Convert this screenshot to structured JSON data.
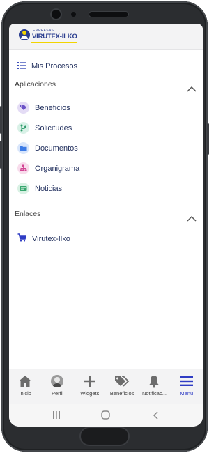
{
  "header": {
    "logo": {
      "top_text": "EMPRESAS",
      "main_text": "VIRUTEX-ILKO",
      "color": "#2a3d8f",
      "accent": "#f2d400"
    }
  },
  "mis_procesos": {
    "label": "Mis Procesos",
    "icon": "list-icon"
  },
  "aplicaciones": {
    "title": "Aplicaciones",
    "expanded": true,
    "items": [
      {
        "label": "Beneficios",
        "icon": "tag-icon",
        "icon_bg": "#e4dcf5",
        "icon_color": "#6b52c7"
      },
      {
        "label": "Solicitudes",
        "icon": "branch-icon",
        "icon_bg": "#d9f1e7",
        "icon_color": "#2e9a6a"
      },
      {
        "label": "Documentos",
        "icon": "folder-icon",
        "icon_bg": "#d9e6fb",
        "icon_color": "#3d7ce6"
      },
      {
        "label": "Organigrama",
        "icon": "org-chart-icon",
        "icon_bg": "#f8dcec",
        "icon_color": "#d24594"
      },
      {
        "label": "Noticias",
        "icon": "news-icon",
        "icon_bg": "#d9f1e4",
        "icon_color": "#37a66e"
      }
    ]
  },
  "enlaces": {
    "title": "Enlaces",
    "expanded": true,
    "items": [
      {
        "label": "Virutex-Ilko",
        "icon": "cart-icon",
        "icon_color": "#2f3cc4"
      }
    ]
  },
  "tabbar": {
    "tabs": [
      {
        "label": "Inicio",
        "icon": "home-icon"
      },
      {
        "label": "Perfil",
        "icon": "avatar"
      },
      {
        "label": "Widgets",
        "icon": "plus-icon"
      },
      {
        "label": "Beneficios",
        "icon": "tags-icon"
      },
      {
        "label": "Notificac...",
        "icon": "bell-icon"
      },
      {
        "label": "Menú",
        "icon": "hamburger-icon",
        "active": true,
        "active_color": "#2f3cc4"
      }
    ]
  },
  "android_nav": {
    "buttons": [
      "recents-icon",
      "home-circle-icon",
      "back-icon"
    ]
  }
}
